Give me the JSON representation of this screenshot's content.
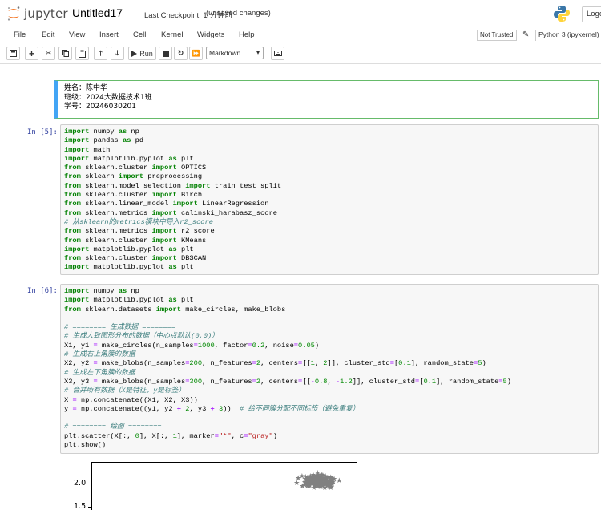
{
  "header": {
    "logo_text": "jupyter",
    "notebook_title": "Untitled17",
    "checkpoint": "Last Checkpoint: 1 分钟前",
    "autosave": "(unsaved changes)",
    "logout_label": "Logo"
  },
  "menu": {
    "items": [
      "File",
      "Edit",
      "View",
      "Insert",
      "Cell",
      "Kernel",
      "Widgets",
      "Help"
    ],
    "trusted": "Not Trusted",
    "kernel": "Python 3 (ipykernel)"
  },
  "toolbar": {
    "run_label": "Run",
    "cell_type": "Markdown"
  },
  "cells": {
    "markdown": {
      "lines": [
        "姓名：陈中华",
        "班级：2024大数据技术1班",
        "学号：20246030201"
      ]
    },
    "cell1": {
      "prompt": "In  [5]:"
    },
    "cell2": {
      "prompt": "In  [6]:"
    }
  },
  "output_plot": {
    "ytick_labels": [
      "2.0",
      "1.5"
    ],
    "marker_color": "#808080"
  },
  "colors": {
    "selected_border": "#42a5f5",
    "edit_border": "#66bb6a",
    "prompt": "#303f9f",
    "jupyter_orange": "#f37726"
  }
}
